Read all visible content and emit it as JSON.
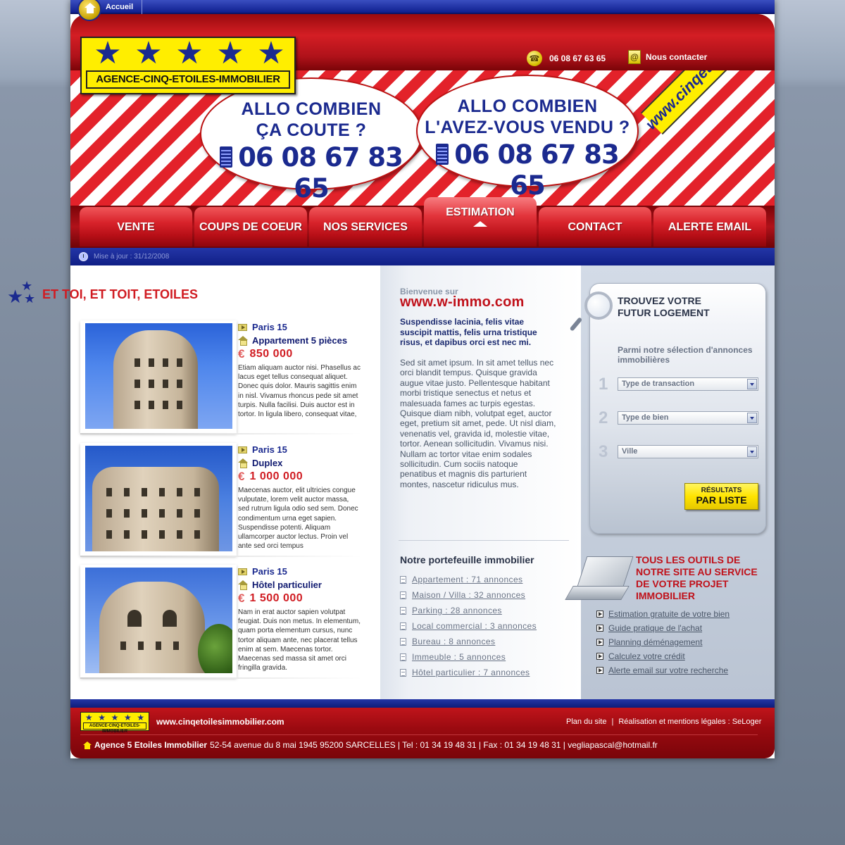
{
  "topbar": {
    "home_label": "Accueil"
  },
  "header": {
    "logo_text": "AGENCE-CINQ-ETOILES-IMMOBILIER",
    "phone": "06 08 67 63 65",
    "contact_label": "Nous contacter"
  },
  "banner": {
    "bubble1": {
      "line1": "ALLO COMBIEN",
      "line2": "ÇA COUTE ?",
      "phone": "06 08 67 83 65"
    },
    "bubble2": {
      "line1": "ALLO COMBIEN",
      "line2": "L'AVEZ-VOUS VENDU ?",
      "phone": "06 08 67 83 65"
    },
    "ribbon": "www.cinqetoilesimmobilier.com"
  },
  "nav": {
    "items": [
      {
        "label": "VENTE"
      },
      {
        "label": "COUPS DE COEUR"
      },
      {
        "label": "NOS SERVICES"
      },
      {
        "label": "ESTIMATION"
      },
      {
        "label": "CONTACT"
      },
      {
        "label": "ALERTE EMAIL"
      }
    ],
    "active": "ESTIMATION"
  },
  "update": {
    "text": "Mise à jour : 31/12/2008"
  },
  "left": {
    "title": "ET TOI, ET TOIT, ETOILES",
    "listings": [
      {
        "city": "Paris 15",
        "type": "Appartement 5 pièces",
        "currency": "€",
        "price": "850 000",
        "description": "Etiam aliquam auctor nisi. Phasellus ac lacus eget tellus consequat aliquet. Donec quis dolor. Mauris sagittis enim in nisl. Vivamus rhoncus pede sit amet turpis. Nulla facilisi. Duis auctor est in tortor. In ligula libero, consequat vitae,"
      },
      {
        "city": "Paris 15",
        "type": "Duplex",
        "currency": "€",
        "price": "1 000 000",
        "description": "Maecenas auctor, elit ultricies congue vulputate, lorem velit auctor massa, sed rutrum ligula odio sed sem. Donec condimentum urna eget sapien. Suspendisse potenti. Aliquam ullamcorper auctor lectus. Proin vel ante sed orci tempus"
      },
      {
        "city": "Paris 15",
        "type": "Hôtel particulier",
        "currency": "€",
        "price": "1 500 000",
        "description": "Nam in erat auctor sapien volutpat feugiat. Duis non metus. In elementum, quam porta elementum cursus, nunc tortor aliquam ante, nec placerat tellus enim at sem. Maecenas tortor. Maecenas sed massa sit amet orci fringilla gravida."
      }
    ]
  },
  "middle": {
    "welcome_small": "Bienvenue sur",
    "welcome_site": "www.w-immo.com",
    "intro_bold": "Suspendisse lacinia, felis vitae suscipit mattis, felis urna tristique risus, et dapibus orci est nec mi.",
    "intro_body": "Sed sit amet ipsum. In sit amet tellus nec orci blandit tempus. Quisque gravida augue vitae justo. Pellentesque habitant morbi tristique senectus et netus et malesuada fames ac turpis egestas. Quisque diam nibh, volutpat eget, auctor eget, pretium sit amet, pede. Ut nisl diam, venenatis vel, gravida id, molestie vitae, tortor. Aenean sollicitudin. Vivamus nisi. Nullam ac tortor vitae enim sodales sollicitudin. Cum sociis natoque penatibus et magnis dis parturient montes, nascetur ridiculus mus.",
    "portfolio_title": "Notre portefeuille immobilier",
    "portfolio": [
      "Appartement : 71 annonces",
      "Maison / Villa : 32 annonces",
      "Parking : 28 annonces",
      "Local commercial : 3 annonces",
      "Bureau : 8 annonces",
      "Immeuble : 5 annonces",
      "Hôtel particulier : 7 annonces"
    ]
  },
  "search": {
    "title_line1": "TROUVEZ VOTRE",
    "title_line2": "FUTUR LOGEMENT",
    "subtitle": "Parmi notre sélection d'annonces immobilières",
    "steps": [
      {
        "num": "1",
        "placeholder": "Type de transaction"
      },
      {
        "num": "2",
        "placeholder": "Type de bien"
      },
      {
        "num": "3",
        "placeholder": "Ville"
      }
    ],
    "button_small": "RÉSULTATS",
    "button_big": "PAR LISTE"
  },
  "tools": {
    "title": "TOUS LES OUTILS DE NOTRE SITE AU SERVICE DE VOTRE PROJET IMMOBILIER",
    "links": [
      "Estimation gratuite de votre bien",
      "Guide pratique de l'achat",
      "Planning déménagement",
      "Calculez votre crédit",
      "Alerte email sur votre recherche"
    ]
  },
  "footer": {
    "logo_text": "AGENCE-CINQ-ETOILES-IMMOBILIER",
    "site": "www.cinqetoilesimmobilier.com",
    "link_plan": "Plan du site",
    "link_legal": "Réalisation et mentions légales : SeLoger",
    "agency_name": "Agence 5 Etoiles Immobilier",
    "address": "52-54 avenue du 8 mai 1945 95200 SARCELLES | Tel : 01 34 19 48 31 | Fax : 01 34 19 48 31 | vegliapascal@hotmail.fr"
  }
}
